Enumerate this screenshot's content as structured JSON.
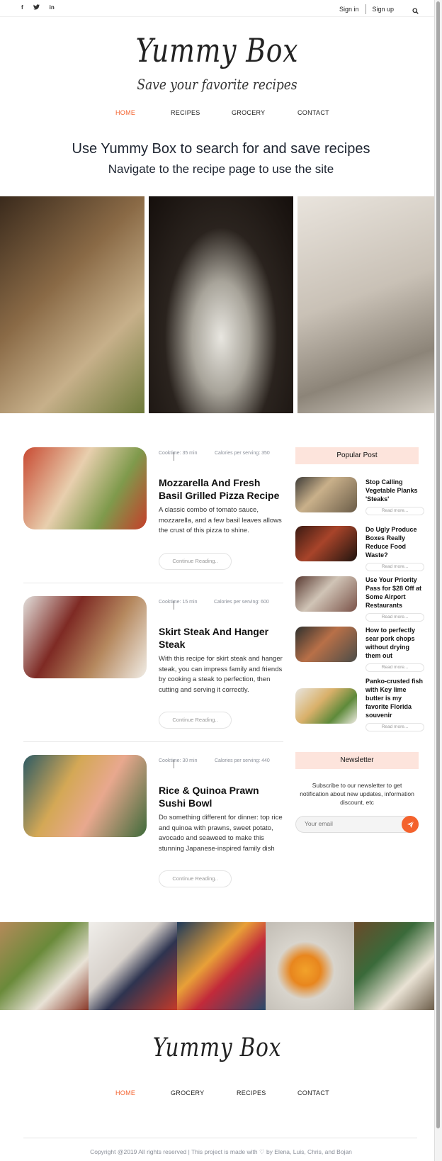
{
  "header": {
    "social": [
      {
        "icon": "facebook-icon",
        "glyph": "f"
      },
      {
        "icon": "twitter-icon",
        "glyph": "t"
      },
      {
        "icon": "linkedin-icon",
        "glyph": "in"
      }
    ],
    "sign_in": "Sign in",
    "sign_up": "Sign up",
    "search_icon": "search-icon"
  },
  "brand": {
    "logo": "Yummy Box",
    "tagline": "Save your favorite recipes",
    "accent_color": "#f4622d"
  },
  "nav": {
    "home": "HOME",
    "recipes": "RECIPES",
    "grocery": "GROCERY",
    "contact": "CONTACT"
  },
  "hero": {
    "headline1": "Use Yummy Box to search for and save recipes",
    "headline2": "Navigate to the recipe page to use the site"
  },
  "posts": [
    {
      "cooktime": "Cooktime: 35 min",
      "calories": "Calories per serving: 350",
      "title": "Mozzarella And Fresh Basil Grilled Pizza Recipe",
      "excerpt": "A classic combo of tomato sauce, mozzarella, and a few basil leaves allows the crust of this pizza to shine.",
      "button": "Continue Reading.."
    },
    {
      "cooktime": "Cooktime: 15 min",
      "calories": "Calories per serving: 600",
      "title": "Skirt Steak And Hanger Steak",
      "excerpt": "With this recipe for skirt steak and hanger steak, you can impress family and friends by cooking a steak to perfection, then cutting and serving it correctly.",
      "button": "Continue Reading.."
    },
    {
      "cooktime": "Cooktime: 30 min",
      "calories": "Calories per serving: 440",
      "title": "Rice & Quinoa Prawn Sushi Bowl",
      "excerpt": "Do something different for dinner: top rice and quinoa with prawns, sweet potato, avocado and seaweed to make this stunning Japanese-inspired family dish",
      "button": "Continue Reading.."
    }
  ],
  "sidebar": {
    "popular_title": "Popular Post",
    "popular": [
      {
        "title": "Stop Calling Vegetable Planks 'Steaks'",
        "read": "Read more..."
      },
      {
        "title": "Do Ugly Produce Boxes Really Reduce Food Waste?",
        "read": "Read more..."
      },
      {
        "title": "Use Your Priority Pass for $28 Off at Some Airport Restaurants",
        "read": "Read more..."
      },
      {
        "title": "How to perfectly sear pork chops without drying them out",
        "read": "Read more..."
      },
      {
        "title": "Panko-crusted fish with Key lime butter is my favorite Florida souvenir",
        "read": "Read more..."
      }
    ],
    "newsletter_title": "Newsletter",
    "newsletter_text": "Subscribe to our newsletter to get notification about new updates, information discount, etc",
    "email_placeholder": "Your email",
    "send_icon": "send-icon"
  },
  "footer": {
    "logo": "Yummy Box",
    "nav": {
      "home": "HOME",
      "grocery": "GROCERY",
      "recipes": "RECIPES",
      "contact": "CONTACT"
    },
    "copyright": "Copyright @2019 All rights reserved | This project is made with ♡ by Elena, Luis, Chris, and Bojan"
  }
}
